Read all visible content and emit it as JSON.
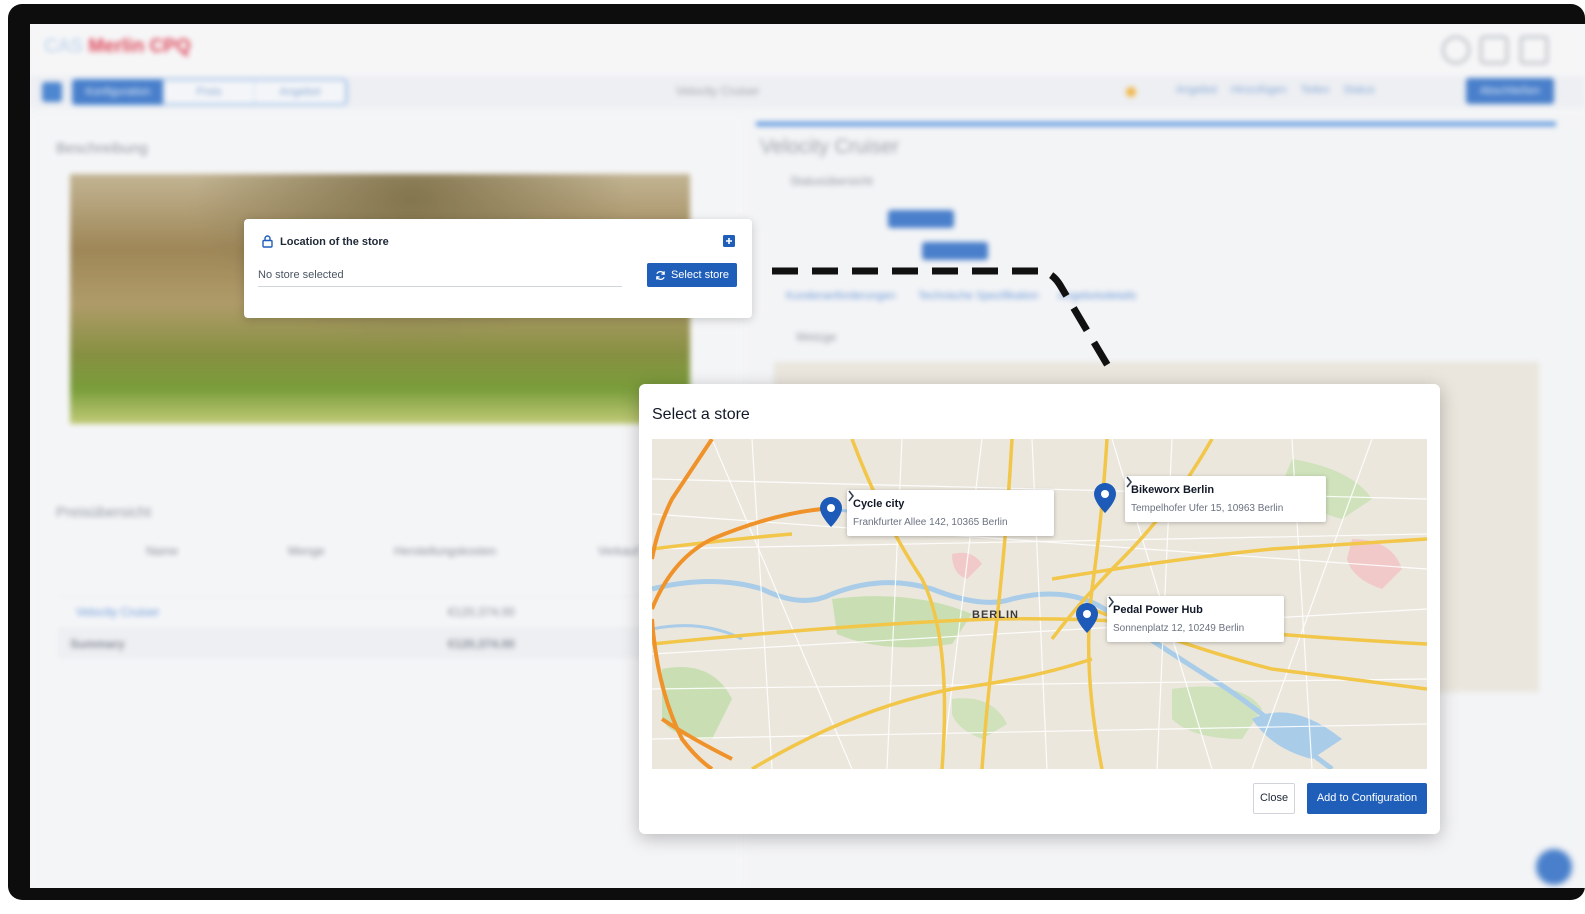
{
  "background_app": {
    "logo_prefix": "CAS",
    "logo_text": "Merlin CPQ",
    "tabs": [
      "Konfiguration",
      "Preis",
      "Angebot"
    ],
    "product_title": "Velocity Cruiser",
    "toolbar_links": [
      "Angebot",
      "Hinzufügen",
      "Teilen",
      "Status"
    ],
    "primary_action": "Abschließen",
    "left_sections": [
      "Beschreibung",
      "Preisübersicht"
    ],
    "price_table_headers": [
      "Name",
      "Menge",
      "Herstellungskosten",
      "Verkauf"
    ],
    "price_rows": [
      {
        "name": "Velocity Cruiser",
        "cost": "€120,374.00"
      },
      {
        "name": "Summary",
        "cost": "€120,374.00"
      }
    ],
    "right_title": "Velocity Cruiser",
    "right_tabs": [
      "Kundenanforderungen",
      "Technische Spezifikation",
      "Angebotsdetails"
    ],
    "status_heading": "Statusübersicht",
    "map_section_label": "Wetzge"
  },
  "location_card": {
    "title": "Location of the store",
    "value": "No store selected",
    "select_button": "Select store"
  },
  "modal": {
    "title": "Select a store",
    "city": "BERLIN",
    "stores": [
      {
        "name": "Cycle city",
        "address": "Frankfurter Allee 142, 10365 Berlin"
      },
      {
        "name": "Bikeworx Berlin",
        "address": "Tempelhofer Ufer 15, 10963 Berlin"
      },
      {
        "name": "Pedal Power Hub",
        "address": "Sonnenplatz 12, 10249 Berlin"
      }
    ],
    "close_button": "Close",
    "add_button": "Add to Configuration"
  },
  "colors": {
    "primary": "#1f5fba",
    "pin": "#1e5bb8",
    "logo": "#d9263b",
    "road_major": "#f2c649",
    "road_highway": "#f0922a",
    "water": "#a9cce8",
    "park": "#c9dfb3"
  }
}
